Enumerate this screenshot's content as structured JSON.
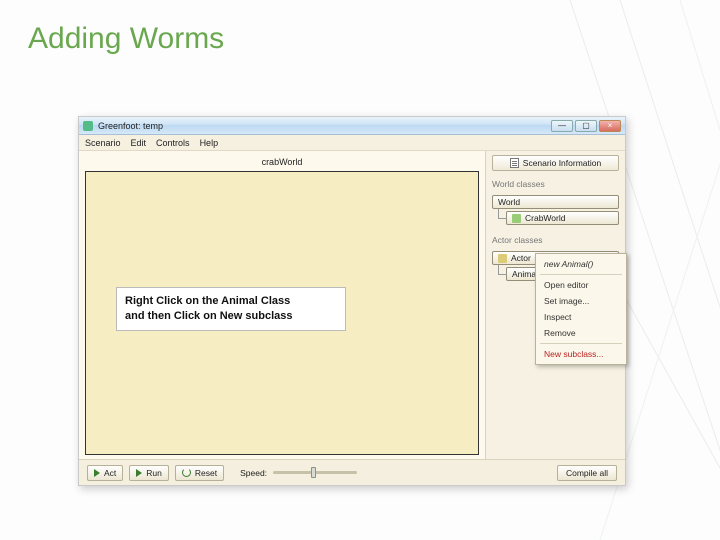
{
  "slide": {
    "title": "Adding Worms"
  },
  "window": {
    "title": "Greenfoot: temp",
    "min": "—",
    "max": "▢",
    "close": "×"
  },
  "menu": {
    "scenario": "Scenario",
    "edit": "Edit",
    "controls": "Controls",
    "help": "Help"
  },
  "world": {
    "label": "crabWorld",
    "callout_line1": "Right Click on the Animal Class",
    "callout_line2": "and then Click on New subclass"
  },
  "panel": {
    "scenario_info": "Scenario Information",
    "world_classes_label": "World classes",
    "world": "World",
    "crabworld": "CrabWorld",
    "actor_classes_label": "Actor classes",
    "actor": "Actor",
    "animal": "Animal"
  },
  "context_menu": {
    "new_animal": "new Animal()",
    "open_editor": "Open editor",
    "set_image": "Set image...",
    "inspect": "Inspect",
    "remove": "Remove",
    "new_subclass": "New subclass..."
  },
  "controls": {
    "act": "Act",
    "run": "Run",
    "reset": "Reset",
    "speed": "Speed:",
    "compile": "Compile all"
  }
}
